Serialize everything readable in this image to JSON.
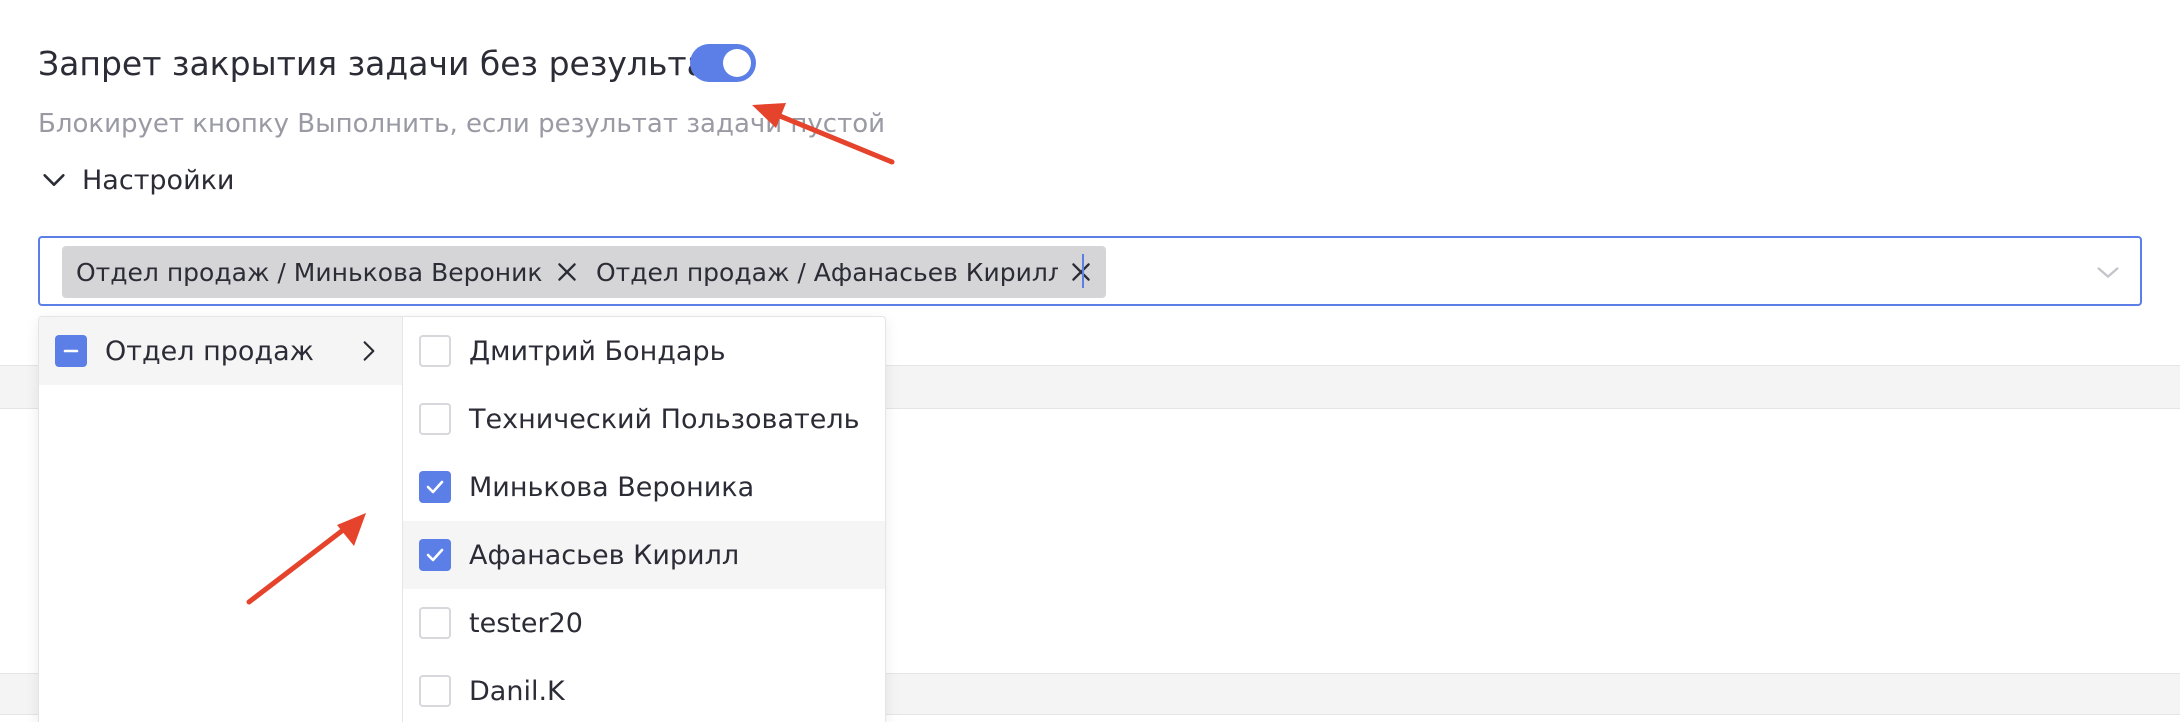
{
  "setting": {
    "title": "Запрет закрытия задачи без результата",
    "description": "Блокирует кнопку Выполнить, если результат задачи пустой",
    "enabled": true,
    "settings_label": "Настройки"
  },
  "multiselect": {
    "tags": [
      {
        "label": "Отдел продаж / Минькова Вероника"
      },
      {
        "label": "Отдел продаж / Афанасьев Кирилл"
      }
    ]
  },
  "cascader": {
    "group": {
      "label": "Отдел продаж",
      "state": "indeterminate"
    },
    "users": [
      {
        "label": "Дмитрий Бондарь",
        "checked": false
      },
      {
        "label": "Технический Пользователь",
        "checked": false
      },
      {
        "label": "Минькова Вероника",
        "checked": true
      },
      {
        "label": "Афанасьев Кирилл",
        "checked": true
      },
      {
        "label": "tester20",
        "checked": false
      },
      {
        "label": "Danil.K",
        "checked": false
      }
    ]
  },
  "colors": {
    "accent": "#5b7fe6",
    "annotation": "#e5432b"
  },
  "icons": {
    "expander": "chevron-down-icon",
    "tag_remove": "close-icon",
    "dropdown": "chevron-down-icon",
    "group_expand": "chevron-right-icon",
    "checkbox_checked": "check-icon",
    "checkbox_partial": "minus-icon"
  }
}
